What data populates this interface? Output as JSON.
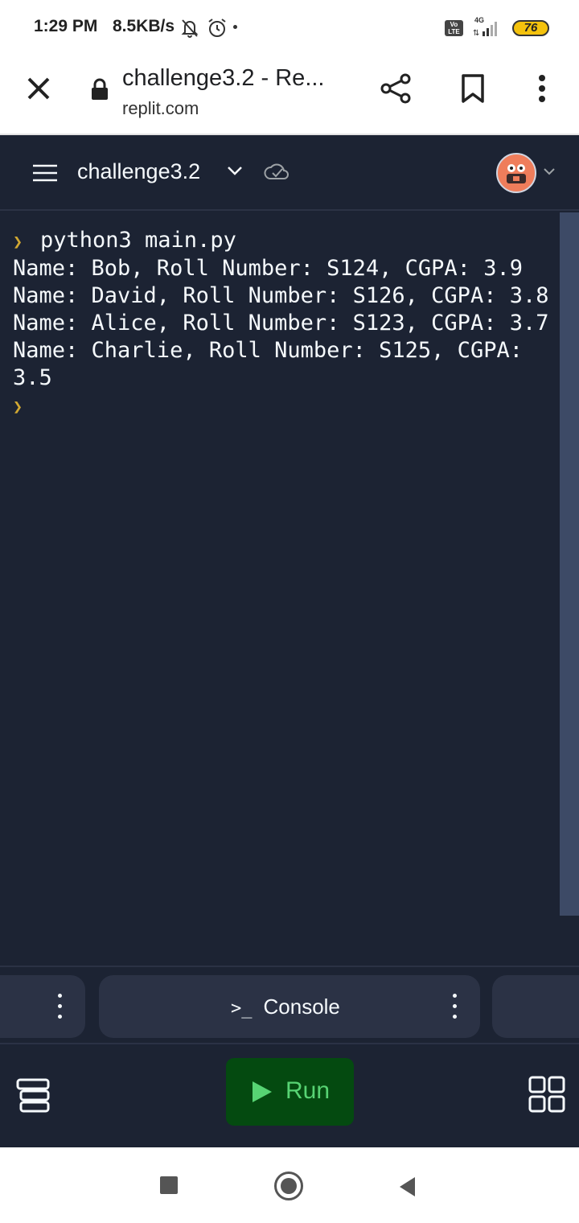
{
  "status_bar": {
    "time": "1:29 PM",
    "speed": "8.5KB/s",
    "volte": "Vo LTE",
    "network": "4G",
    "battery": "76"
  },
  "browser": {
    "page_title": "challenge3.2 - Re...",
    "url": "replit.com"
  },
  "repl": {
    "name": "challenge3.2"
  },
  "console": {
    "command": "python3 main.py",
    "output": [
      "Name: Bob, Roll Number: S124, CGPA: 3.9",
      "Name: David, Roll Number: S126, CGPA: 3.8",
      "Name: Alice, Roll Number: S123, CGPA: 3.7",
      "Name: Charlie, Roll Number: S125, CGPA: 3.5"
    ]
  },
  "tabs": {
    "console_label": "Console",
    "console_icon_text": ">_"
  },
  "toolbar": {
    "run_label": "Run"
  },
  "colors": {
    "background": "#1c2333",
    "run_button": "#044a10",
    "run_text": "#57d373",
    "prompt": "#d1a832",
    "avatar": "#ef7d5b"
  }
}
